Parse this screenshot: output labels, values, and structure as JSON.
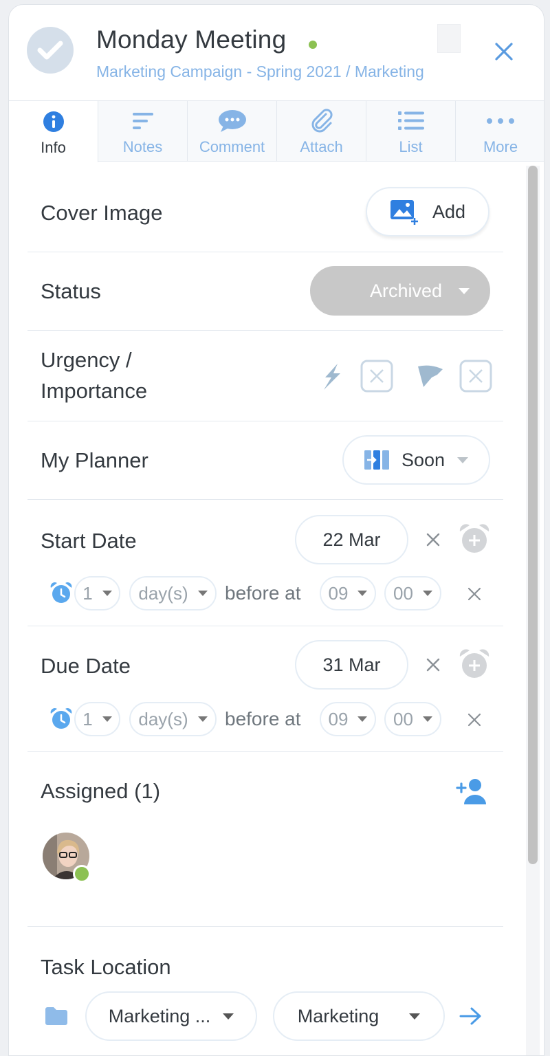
{
  "header": {
    "title": "Monday Meeting",
    "breadcrumb": "Marketing Campaign - Spring 2021 / Marketing"
  },
  "tabs": [
    {
      "label": "Info",
      "icon": "info-icon",
      "active": true
    },
    {
      "label": "Notes",
      "icon": "notes-icon",
      "active": false
    },
    {
      "label": "Comment",
      "icon": "comment-icon",
      "active": false
    },
    {
      "label": "Attach",
      "icon": "paperclip-icon",
      "active": false
    },
    {
      "label": "List",
      "icon": "list-icon",
      "active": false
    },
    {
      "label": "More",
      "icon": "more-icon",
      "active": false
    }
  ],
  "cover_image": {
    "label": "Cover Image",
    "button": "Add"
  },
  "status": {
    "label": "Status",
    "value": "Archived"
  },
  "urgency": {
    "label_line1": "Urgency /",
    "label_line2": "Importance"
  },
  "planner": {
    "label": "My Planner",
    "value": "Soon"
  },
  "start_date": {
    "label": "Start Date",
    "date": "22 Mar",
    "reminder": {
      "amount": "1",
      "unit": "day(s)",
      "before_at": "before at",
      "hour": "09",
      "minute": "00"
    }
  },
  "due_date": {
    "label": "Due Date",
    "date": "31 Mar",
    "reminder": {
      "amount": "1",
      "unit": "day(s)",
      "before_at": "before at",
      "hour": "09",
      "minute": "00"
    }
  },
  "assigned": {
    "label": "Assigned (1)"
  },
  "task_location": {
    "label": "Task Location",
    "project": "Marketing ...",
    "list": "Marketing"
  },
  "colors": {
    "accent": "#4a90e2",
    "link": "#86b4e6",
    "online": "#8cc152",
    "archived": "#c8c8c8"
  }
}
